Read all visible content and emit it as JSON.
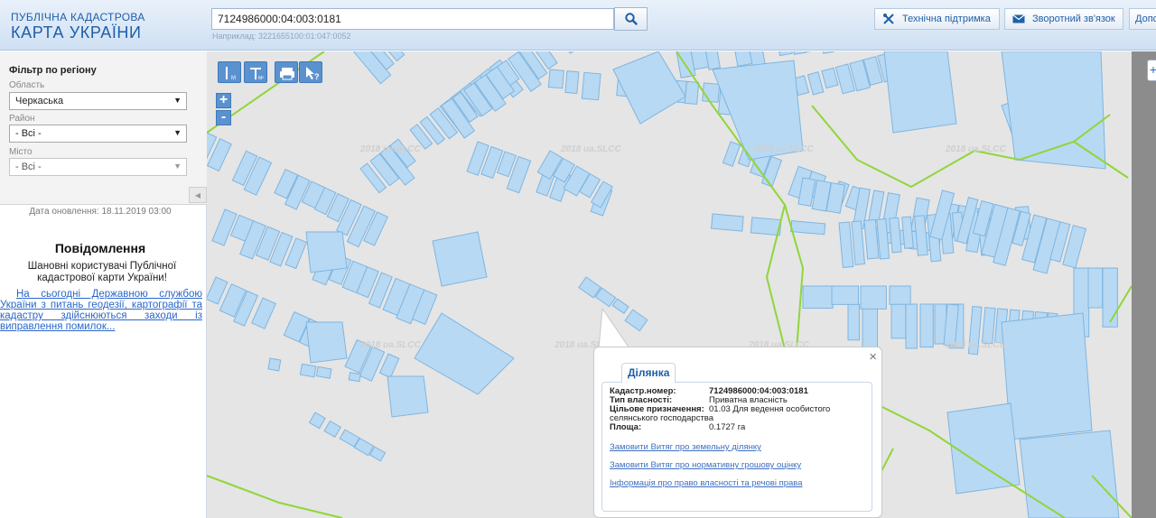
{
  "header": {
    "logo_top": "ПУБЛІЧНА КАДАСТРОВА",
    "logo_main": "КАРТА УКРАЇНИ",
    "search_value": "7124986000:04:003:0181",
    "search_hint": "Наприклад: 3221655100:01:047:0052",
    "buttons": {
      "support": "Технічна підтримка",
      "feedback": "Зворотний зв'язок",
      "more": "Допомога"
    }
  },
  "sidebar": {
    "filter_title": "Фільтр по регіону",
    "oblast_label": "Область",
    "oblast_value": "Черкаська",
    "rayon_label": "Район",
    "rayon_value": "- Всі -",
    "misto_label": "Місто",
    "misto_value": "- Всі -",
    "update_date": "Дата оновлення: 18.11.2019 03:00",
    "message_title": "Повідомлення",
    "message_text": "Шановні користувачі Публічної кадастрової карти України!",
    "message_link": "На сьогодні Державною службою України з питань геодезії, картографії та кадастру здійснюються заходи із виправлення помилок..."
  },
  "map": {
    "watermark": "2018 ua.SLCC",
    "zoom_in": "+",
    "zoom_out": "-"
  },
  "popup": {
    "tab": "Ділянка",
    "cadastral_label": "Кадастр.номер:",
    "cadastral_value": "7124986000:04:003:0181",
    "ownership_label": "Тип власності:",
    "ownership_value": "Приватна власність",
    "purpose_label": "Цільове призначення:",
    "purpose_value": "01.03 Для ведення особистого",
    "purpose_value_cont": "селянського господарства",
    "area_label": "Площа:",
    "area_value": "0.1727 га",
    "link1": "Замовити Витяг про земельну ділянку",
    "link2": "Замовити Витяг про нормативну грошову оцінку",
    "link3": "Інформація про право власності та речові права"
  },
  "colors": {
    "parcel_fill": "#b8d9f3",
    "parcel_stroke": "#7fb5e0",
    "boundary": "#8fd63a",
    "brand": "#1f5fa8"
  }
}
